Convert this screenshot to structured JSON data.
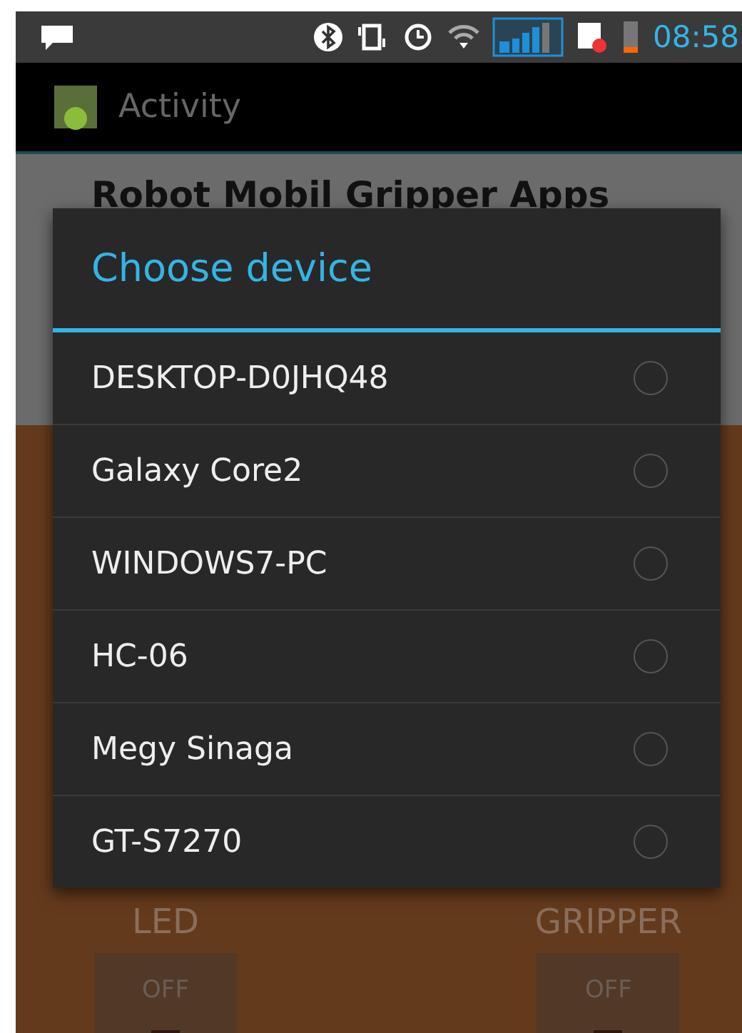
{
  "status_bar": {
    "time": "08:58"
  },
  "action_bar": {
    "title": "Activity"
  },
  "app": {
    "heading": "Robot Mobil Gripper Apps",
    "toggles": [
      {
        "label": "LED",
        "state_text": "OFF",
        "on": false
      },
      {
        "label": "GRIPPER",
        "state_text": "OFF",
        "on": false
      }
    ]
  },
  "dialog": {
    "title": "Choose device",
    "items": [
      {
        "label": "DESKTOP-D0JHQ48",
        "selected": false
      },
      {
        "label": "Galaxy Core2",
        "selected": false
      },
      {
        "label": "WINDOWS7-PC",
        "selected": false
      },
      {
        "label": "HC-06",
        "selected": false
      },
      {
        "label": "Megy Sinaga",
        "selected": false
      },
      {
        "label": "GT-S7270",
        "selected": false
      }
    ]
  }
}
